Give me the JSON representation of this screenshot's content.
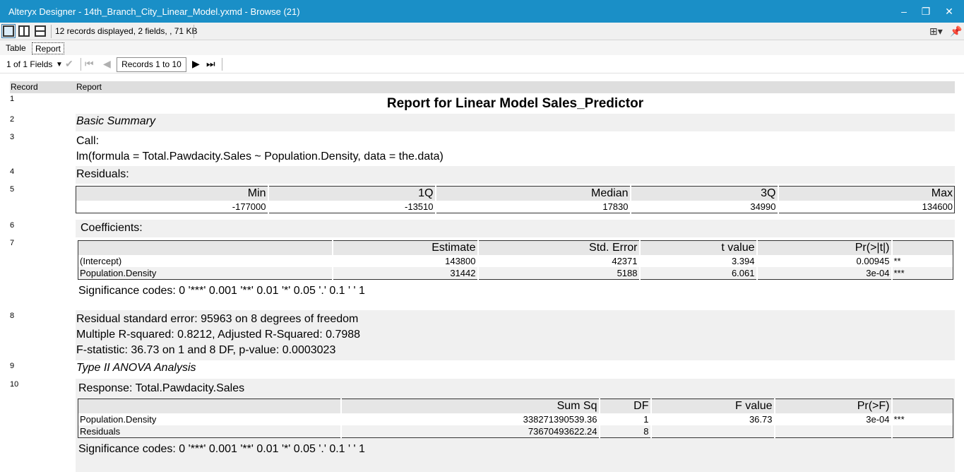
{
  "window": {
    "title": "Alteryx Designer  -  14th_Branch_City_Linear_Model.yxmd  -  Browse (21)"
  },
  "toolbar": {
    "status": "12 records displayed, 2 fields, , 71 KB"
  },
  "tabs": [
    {
      "label": "Table"
    },
    {
      "label": "Report"
    }
  ],
  "nav": {
    "fields": "1 of 1 Fields",
    "records": "Records 1 to 10"
  },
  "grid": {
    "col_record": "Record",
    "col_report": "Report"
  },
  "rows": {
    "r1": {
      "num": "1",
      "title": "Report for Linear Model Sales_Predictor"
    },
    "r2": {
      "num": "2",
      "text": "Basic Summary"
    },
    "r3": {
      "num": "3",
      "line1": "Call:",
      "line2": "lm(formula = Total.Pawdacity.Sales ~ Population.Density, data = the.data)"
    },
    "r4": {
      "num": "4",
      "text": "Residuals:"
    },
    "r5": {
      "num": "5",
      "headers": [
        "Min",
        "1Q",
        "Median",
        "3Q",
        "Max"
      ],
      "values": [
        "-177000",
        "-13510",
        "17830",
        "34990",
        "134600"
      ]
    },
    "r6": {
      "num": "6",
      "text": "Coefficients:"
    },
    "r7": {
      "num": "7",
      "headers": [
        "",
        "Estimate",
        "Std. Error",
        "t value",
        "Pr(>|t|)",
        ""
      ],
      "rows": [
        [
          "(Intercept)",
          "143800",
          "42371",
          "3.394",
          "0.00945",
          "**"
        ],
        [
          "Population.Density",
          "31442",
          "5188",
          "6.061",
          "3e-04",
          "***"
        ]
      ],
      "sig": "Significance codes: 0 '***' 0.001 '**' 0.01 '*' 0.05 '.' 0.1 ' ' 1"
    },
    "r8": {
      "num": "8",
      "line1": "Residual standard error: 95963 on 8 degrees of freedom",
      "line2": "Multiple R-squared: 0.8212, Adjusted R-Squared: 0.7988",
      "line3": "F-statistic: 36.73 on 1 and 8 DF, p-value: 0.0003023"
    },
    "r9": {
      "num": "9",
      "text": "Type II ANOVA Analysis"
    },
    "r10": {
      "num": "10",
      "response": "Response: Total.Pawdacity.Sales",
      "headers": [
        "",
        "Sum Sq",
        "DF",
        "F value",
        "Pr(>F)",
        ""
      ],
      "rows": [
        [
          "Population.Density",
          "338271390539.36",
          "1",
          "36.73",
          "3e-04",
          "***"
        ],
        [
          "Residuals",
          "73670493622.24",
          "8",
          "",
          "",
          ""
        ]
      ],
      "sig": "Significance codes: 0 '***' 0.001 '**' 0.01 '*' 0.05 '.' 0.1 ' ' 1"
    }
  }
}
